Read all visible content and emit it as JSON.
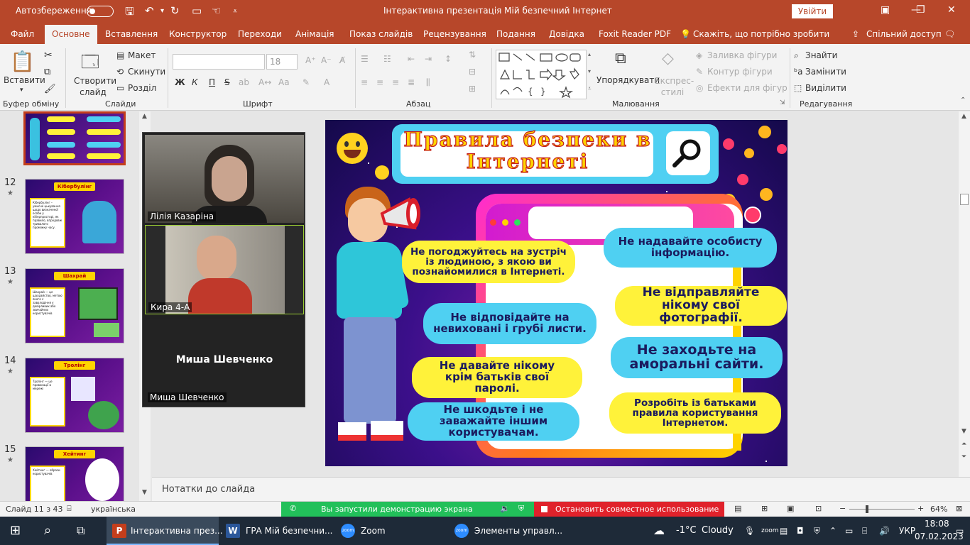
{
  "title_bar": {
    "autosave_label": "Автозбереження",
    "autosave_state": "off",
    "doc_title": "Інтерактивна презентація Мій безпечний Інтернет",
    "sign_in": "Увійти"
  },
  "tabs": [
    "Файл",
    "Основне",
    "Вставлення",
    "Конструктор",
    "Переходи",
    "Анімація",
    "Показ слайдів",
    "Рецензування",
    "Подання",
    "Довідка",
    "Foxit Reader PDF",
    "Скажіть, що потрібно зробити",
    "Спільний доступ"
  ],
  "ribbon": {
    "clipboard": {
      "paste": "Вставити",
      "group": "Буфер обміну"
    },
    "slides": {
      "new_slide": "Створити слайд",
      "layout": "Макет",
      "reset": "Скинути",
      "section": "Розділ",
      "group": "Слайди"
    },
    "font": {
      "font_name": "",
      "font_size": "18",
      "bold": "Ж",
      "italic": "К",
      "underline": "П",
      "strike": "S",
      "group": "Шрифт"
    },
    "paragraph": {
      "group": "Абзац"
    },
    "drawing": {
      "arrange": "Упорядкувати",
      "quick_styles": "Експрес-стилі",
      "fill": "Заливка фігури",
      "outline": "Контур фігури",
      "effects": "Ефекти для фігур",
      "group": "Малювання"
    },
    "editing": {
      "find": "Знайти",
      "replace": "Замінити",
      "select": "Виділити",
      "group": "Редагування"
    }
  },
  "thumbnails": [
    {
      "num": "12",
      "title": "Кібербулінг",
      "text": "Кібербулінг – умисне цькування щодо визначеної особи у кіберпросторі, як правило, впродовж тривалого проміжку часу."
    },
    {
      "num": "13",
      "title": "Шахрай",
      "text": "Шахрай — це шахрайство, метою якого є заволодіння у довірливих або звичайних користувачів"
    },
    {
      "num": "14",
      "title": "Тролінг",
      "text": "Тролінг — це провокації в мережі"
    },
    {
      "num": "15",
      "title": "Хейтинг",
      "text": "Хейтинг — образи користувачів"
    }
  ],
  "zoom": {
    "participants": [
      "Лілія Казаріна",
      "Кира 4-А",
      "Миша Шевченко"
    ],
    "center_name": "Миша Шевченко"
  },
  "slide": {
    "title": "Правила безпеки в Інтернеті",
    "rules": [
      "Не погоджуйтесь на зустріч із людиною, з якою ви познайомилися в Інтернеті.",
      "Не надавайте  особисту інформацію.",
      "Не  відправляйте нікому свої фотографії.",
      "Не відповідайте на невиховані і грубі листи.",
      "Не заходьте на аморальні сайти.",
      "Не давайте нікому крім батьків свої паролі.",
      "Розробіть із батьками правила користування Інтернетом.",
      "Не шкодьте і не заважайте іншим користувачам."
    ]
  },
  "notes_placeholder": "Нотатки до слайда",
  "status": {
    "slide_count": "Слайд 11 з 43",
    "language": "українська",
    "share_message": "Вы запустили демонстрацию экрана",
    "stop_share": "Остановить совместное использование",
    "zoom_level": "64%"
  },
  "taskbar": {
    "apps": [
      "Інтерактивна през...",
      "ГРА Мій безпечни...",
      "Zoom",
      "Элементы управл..."
    ],
    "weather": "-1°C",
    "weather_desc": "Cloudy",
    "lang": "УКР",
    "time": "18:08",
    "date": "07.02.2023"
  },
  "colors": {
    "brand": "#b7472a",
    "share_green": "#22c05a",
    "stop_red": "#e0222b"
  }
}
